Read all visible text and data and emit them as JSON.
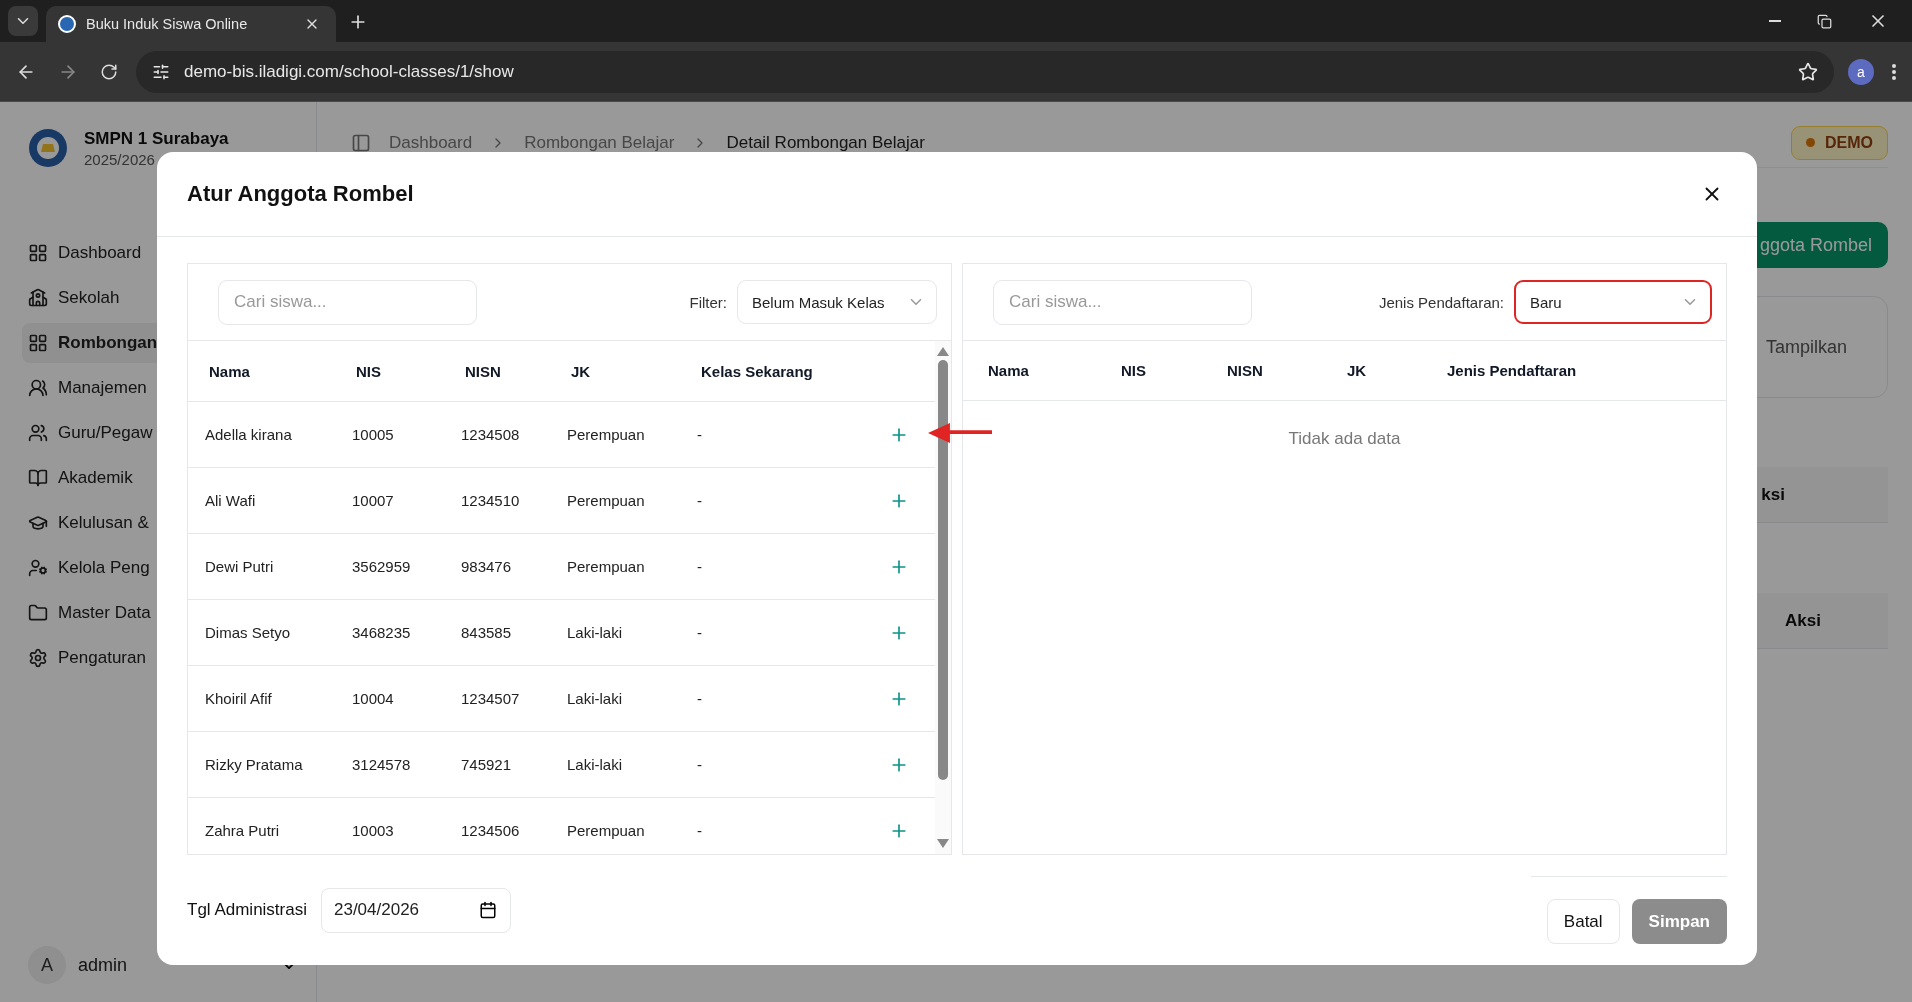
{
  "browser": {
    "tab_title": "Buku Induk Siswa Online",
    "url": "demo-bis.iladigi.com/school-classes/1/show",
    "profile_letter": "a"
  },
  "sidebar": {
    "school_name": "SMPN 1 Surabaya",
    "year": "2025/2026",
    "items": [
      {
        "label": "Dashboard",
        "selected": false
      },
      {
        "label": "Sekolah",
        "selected": false
      },
      {
        "label": "Rombongan",
        "selected": true
      },
      {
        "label": "Manajemen",
        "selected": false
      },
      {
        "label": "Guru/Pegaw",
        "selected": false
      },
      {
        "label": "Akademik",
        "selected": false
      },
      {
        "label": "Kelulusan &",
        "selected": false
      },
      {
        "label": "Kelola Peng",
        "selected": false
      },
      {
        "label": "Master Data",
        "selected": false
      },
      {
        "label": "Pengaturan",
        "selected": false
      }
    ],
    "user": {
      "avatar_letter": "A",
      "name": "admin"
    }
  },
  "breadcrumb": [
    "Dashboard",
    "Rombongan Belajar",
    "Detail Rombongan Belajar"
  ],
  "badge": "DEMO",
  "background": {
    "button_label": "ggota Rombel",
    "card_text": "Tampilkan",
    "table_headers": [
      "ksi",
      "Aksi"
    ]
  },
  "modal": {
    "title": "Atur Anggota Rombel",
    "left": {
      "search_placeholder": "Cari siswa...",
      "filter_label": "Filter:",
      "filter_value": "Belum Masuk Kelas",
      "filter_invalid": false,
      "columns": [
        "Nama",
        "NIS",
        "NISN",
        "JK",
        "Kelas Sekarang"
      ],
      "rows": [
        {
          "nama": "Adella kirana",
          "nis": "10005",
          "nisn": "1234508",
          "jk": "Perempuan",
          "kelas": "-"
        },
        {
          "nama": "Ali Wafi",
          "nis": "10007",
          "nisn": "1234510",
          "jk": "Perempuan",
          "kelas": "-"
        },
        {
          "nama": "Dewi Putri",
          "nis": "3562959",
          "nisn": "983476",
          "jk": "Perempuan",
          "kelas": "-"
        },
        {
          "nama": "Dimas Setyo",
          "nis": "3468235",
          "nisn": "843585",
          "jk": "Laki-laki",
          "kelas": "-"
        },
        {
          "nama": "Khoiril Afif",
          "nis": "10004",
          "nisn": "1234507",
          "jk": "Laki-laki",
          "kelas": "-"
        },
        {
          "nama": "Rizky Pratama",
          "nis": "3124578",
          "nisn": "745921",
          "jk": "Laki-laki",
          "kelas": "-"
        },
        {
          "nama": "Zahra Putri",
          "nis": "10003",
          "nisn": "1234506",
          "jk": "Perempuan",
          "kelas": "-"
        }
      ]
    },
    "right": {
      "search_placeholder": "Cari siswa...",
      "filter_label": "Jenis Pendaftaran:",
      "filter_value": "Baru",
      "filter_invalid": true,
      "columns": [
        "Nama",
        "NIS",
        "NISN",
        "JK",
        "Jenis Pendaftaran"
      ],
      "empty_text": "Tidak ada data"
    },
    "date_label": "Tgl Administrasi",
    "date_value": "23/04/2026",
    "buttons": [
      {
        "label": "Batal",
        "kind": "secondary",
        "disabled": false
      },
      {
        "label": "Simpan",
        "kind": "primary",
        "disabled": true
      }
    ]
  }
}
